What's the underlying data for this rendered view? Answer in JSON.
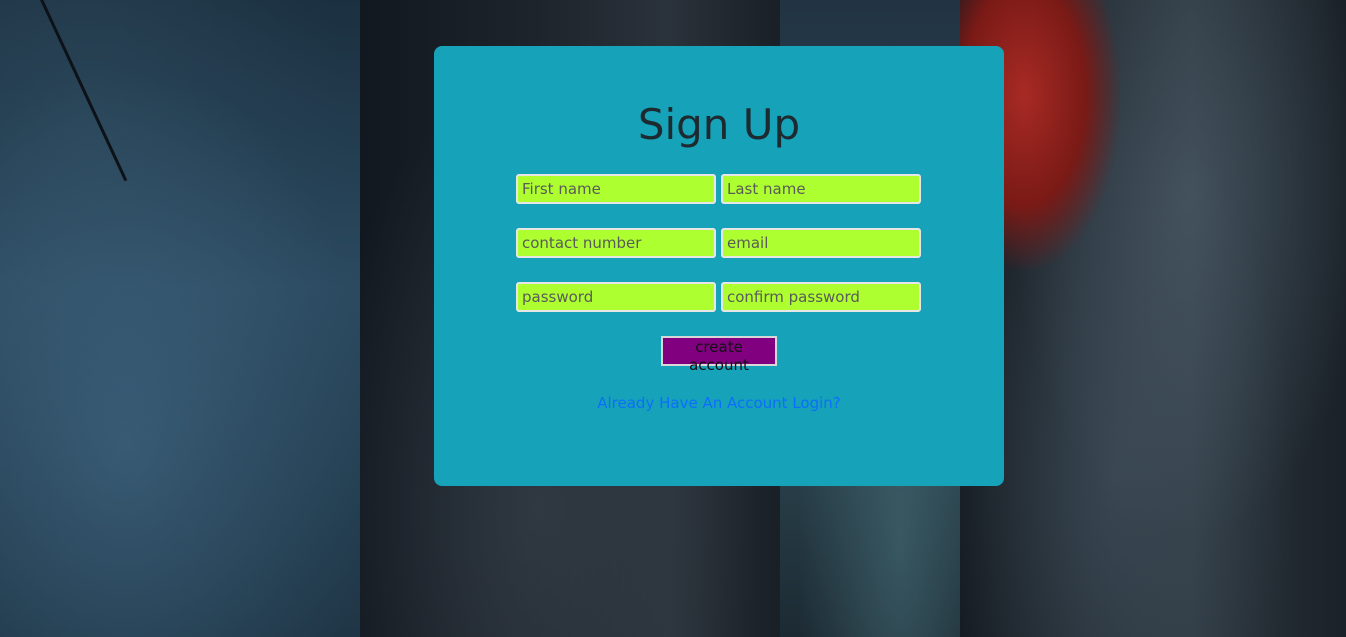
{
  "form": {
    "title": "Sign Up",
    "first_name_placeholder": "First name",
    "last_name_placeholder": "Last name",
    "contact_number_placeholder": "contact number",
    "email_placeholder": "email",
    "password_placeholder": "password",
    "confirm_password_placeholder": "confirm password",
    "submit_label": "create account",
    "login_link_text": "Already Have An Account Login?"
  },
  "colors": {
    "card_background": "#16a2b8",
    "input_background": "#adff2f",
    "button_background": "#800080",
    "link": "#0d6efd"
  }
}
